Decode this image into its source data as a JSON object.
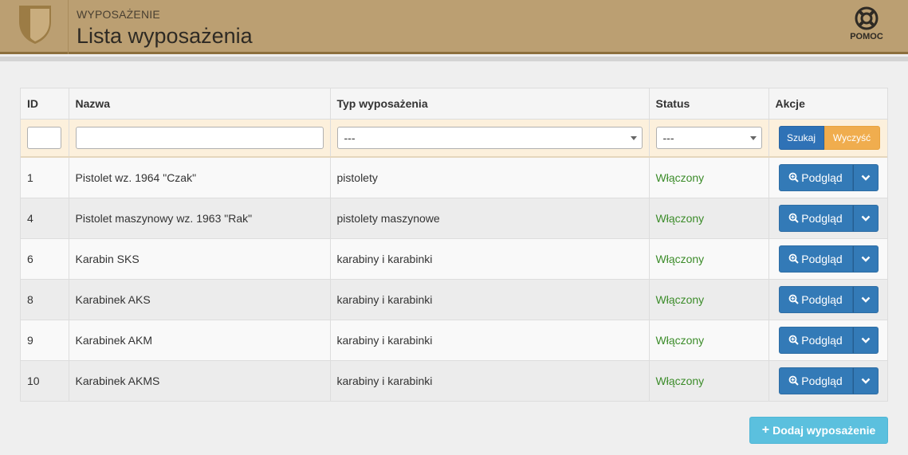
{
  "header": {
    "breadcrumb": "WYPOSAŻENIE",
    "title": "Lista wyposażenia",
    "help_label": "POMOC"
  },
  "colors": {
    "header_bg": "#bb9f72",
    "primary": "#337ab7",
    "warning": "#f0ad4e",
    "info": "#5bc0de",
    "status_active": "#3c8c2a"
  },
  "table": {
    "columns": [
      "ID",
      "Nazwa",
      "Typ wyposażenia",
      "Status",
      "Akcje"
    ],
    "filters": {
      "id_value": "",
      "name_value": "",
      "type_selected": "---",
      "status_selected": "---",
      "search_label": "Szukaj",
      "clear_label": "Wyczyść"
    },
    "rows": [
      {
        "id": "1",
        "name": "Pistolet wz. 1964 \"Czak\"",
        "type": "pistolety",
        "status": "Włączony",
        "action": "Podgląd"
      },
      {
        "id": "4",
        "name": "Pistolet maszynowy wz. 1963 \"Rak\"",
        "type": "pistolety maszynowe",
        "status": "Włączony",
        "action": "Podgląd"
      },
      {
        "id": "6",
        "name": "Karabin SKS",
        "type": "karabiny i karabinki",
        "status": "Włączony",
        "action": "Podgląd"
      },
      {
        "id": "8",
        "name": "Karabinek AKS",
        "type": "karabiny i karabinki",
        "status": "Włączony",
        "action": "Podgląd"
      },
      {
        "id": "9",
        "name": "Karabinek AKM",
        "type": "karabiny i karabinki",
        "status": "Włączony",
        "action": "Podgląd"
      },
      {
        "id": "10",
        "name": "Karabinek AKMS",
        "type": "karabiny i karabinki",
        "status": "Włączony",
        "action": "Podgląd"
      }
    ]
  },
  "add_button_label": "Dodaj wyposażenie",
  "icons": {
    "logo": "shield-logo",
    "help": "lifebuoy-icon",
    "view": "zoom-in-icon",
    "dropdown": "chevron-down-icon",
    "add": "plus-icon"
  }
}
